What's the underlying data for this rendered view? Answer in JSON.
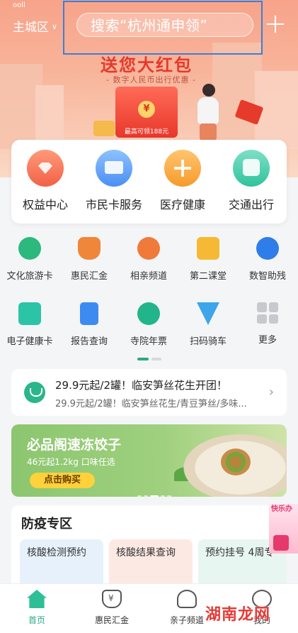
{
  "header": {
    "status": "ooll",
    "city": "主城区",
    "search_placeholder": "搜索“杭州通申领”"
  },
  "promo": {
    "title": "送您大红包",
    "subtitle": "- 数字人民币出行优惠 -",
    "coin_symbol": "¥",
    "caption": "最高可领188元"
  },
  "services": [
    {
      "label": "权益中心",
      "icon": "gem-icon"
    },
    {
      "label": "市民卡服务",
      "icon": "card-icon"
    },
    {
      "label": "医疗健康",
      "icon": "medical-icon"
    },
    {
      "label": "交通出行",
      "icon": "bus-icon"
    }
  ],
  "apps_row1": [
    {
      "label": "文化旅游卡",
      "icon": "ticket-icon"
    },
    {
      "label": "惠民汇金",
      "icon": "money-bag-icon"
    },
    {
      "label": "相亲频道",
      "icon": "couple-icon"
    },
    {
      "label": "第二课堂",
      "icon": "heart-book-icon"
    },
    {
      "label": "数智助残",
      "icon": "accessibility-icon"
    }
  ],
  "apps_row2": [
    {
      "label": "电子健康卡",
      "icon": "health-card-icon"
    },
    {
      "label": "报告查询",
      "icon": "report-icon"
    },
    {
      "label": "寺院年票",
      "icon": "temple-icon"
    },
    {
      "label": "扫码骑车",
      "icon": "bike-scan-icon"
    },
    {
      "label": "更多",
      "icon": "more-grid-icon"
    }
  ],
  "group_buy": {
    "title": "29.9元起/2罐！临安笋丝花生开团！",
    "subtitle": "29.9元起/2罐！临安笋丝花生/青豆笋丝/多味..."
  },
  "food_banner": {
    "title": "必品阁速冻饺子",
    "subtitle": "46元起1.2kg 口味任选",
    "button": "点击购买"
  },
  "epidemic": {
    "title": "防疫专区",
    "tiles": [
      "核酸检测预约",
      "核酸结果查询",
      "预约挂号 4周专"
    ]
  },
  "float_ad": {
    "text": "快乐办"
  },
  "bottom_nav": [
    {
      "label": "首页",
      "icon": "home-icon"
    },
    {
      "label": "惠民汇金",
      "icon": "money-bag-icon"
    },
    {
      "label": "亲子频道",
      "icon": "family-icon"
    },
    {
      "label": "我的",
      "icon": "profile-icon"
    }
  ],
  "watermark": "湖南龙网",
  "colors": {
    "accent_green": "#2aaa8a",
    "banner_top": "#f7a38a",
    "search_outline": "#3b7fd6",
    "promo_red": "#e63a2b"
  }
}
